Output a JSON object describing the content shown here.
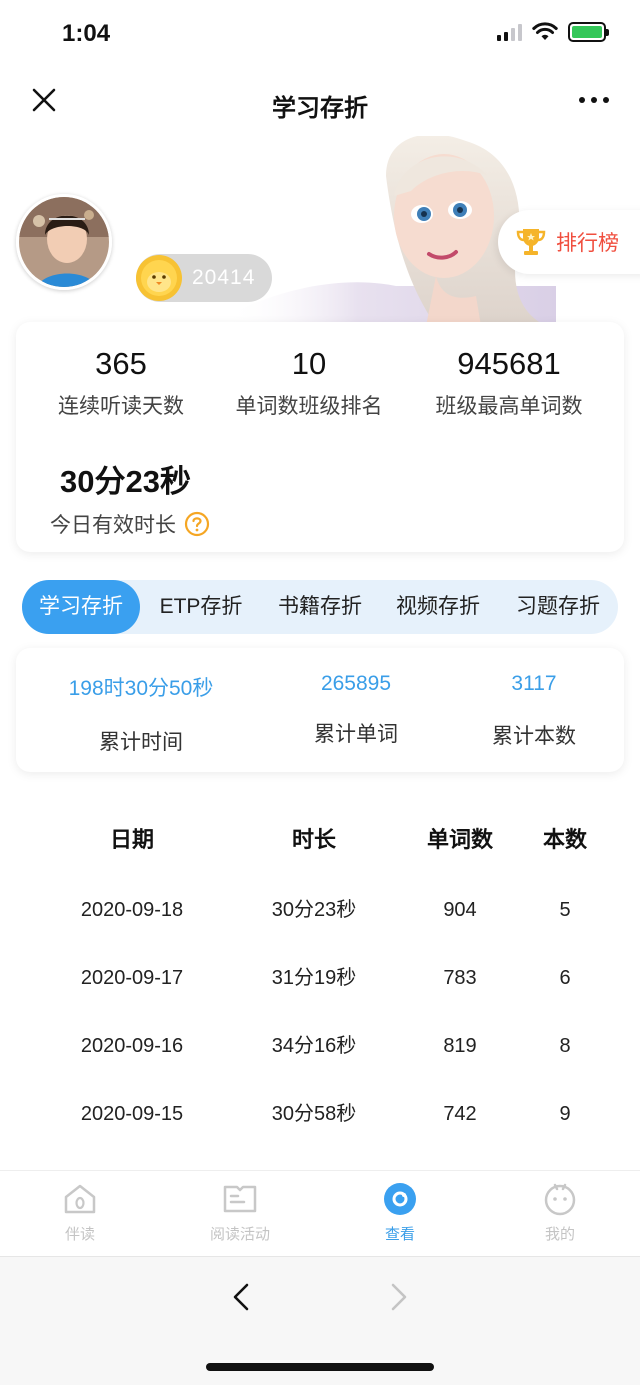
{
  "status_bar": {
    "time": "1:04"
  },
  "nav": {
    "title": "学习存折",
    "close_icon": "close-icon",
    "more_icon": "more-icon"
  },
  "header": {
    "coin_value": "20414",
    "rank_label": "排行榜"
  },
  "stats": [
    {
      "value": "365",
      "label": "连续听读天数"
    },
    {
      "value": "10",
      "label": "单词数班级排名"
    },
    {
      "value": "945681",
      "label": "班级最高单词数"
    },
    {
      "value": "30分23秒",
      "label": "今日有效时长"
    }
  ],
  "tabs": [
    "学习存折",
    "ETP存折",
    "书籍存折",
    "视频存折",
    "习题存折"
  ],
  "summary": [
    {
      "value": "198时30分50秒",
      "label": "累计时间"
    },
    {
      "value": "265895",
      "label": "累计单词"
    },
    {
      "value": "3117",
      "label": "累计本数"
    }
  ],
  "table": {
    "headers": [
      "日期",
      "时长",
      "单词数",
      "本数"
    ],
    "rows": [
      [
        "2020-09-18",
        "30分23秒",
        "904",
        "5"
      ],
      [
        "2020-09-17",
        "31分19秒",
        "783",
        "6"
      ],
      [
        "2020-09-16",
        "34分16秒",
        "819",
        "8"
      ],
      [
        "2020-09-15",
        "30分58秒",
        "742",
        "9"
      ]
    ]
  },
  "tabbar": [
    {
      "label": "伴读",
      "icon": "home-icon"
    },
    {
      "label": "阅读活动",
      "icon": "book-icon"
    },
    {
      "label": "查看",
      "icon": "view-icon"
    },
    {
      "label": "我的",
      "icon": "profile-icon"
    }
  ],
  "colors": {
    "accent": "#3aa0f0",
    "rank_red": "#f04e3e",
    "help_orange": "#f5a623"
  }
}
